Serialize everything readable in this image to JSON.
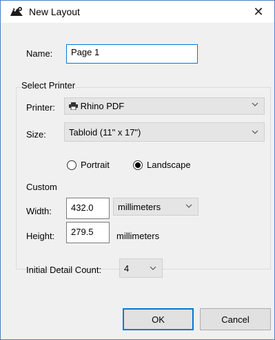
{
  "window": {
    "title": "New Layout",
    "close_glyph": "✕"
  },
  "name": {
    "label": "Name:",
    "value": "Page 1"
  },
  "select_printer": {
    "group_label": "Select Printer",
    "printer_label": "Printer:",
    "printer_icon": "printer-icon",
    "printer_value": "Rhino PDF",
    "size_label": "Size:",
    "size_value": "Tabloid (11\" x 17\")"
  },
  "orientation": {
    "portrait_label": "Portrait",
    "landscape_label": "Landscape",
    "selected": "Landscape"
  },
  "custom": {
    "label": "Custom",
    "width_label": "Width:",
    "width_value": "432.0",
    "width_units": "millimeters",
    "height_label": "Height:",
    "height_value": "279.5",
    "height_units": "millimeters"
  },
  "detail": {
    "label": "Initial Detail Count:",
    "value": "4"
  },
  "buttons": {
    "ok": "OK",
    "cancel": "Cancel"
  },
  "colors": {
    "accent": "#0078d7",
    "dialog_bg": "#f0f0f0"
  }
}
